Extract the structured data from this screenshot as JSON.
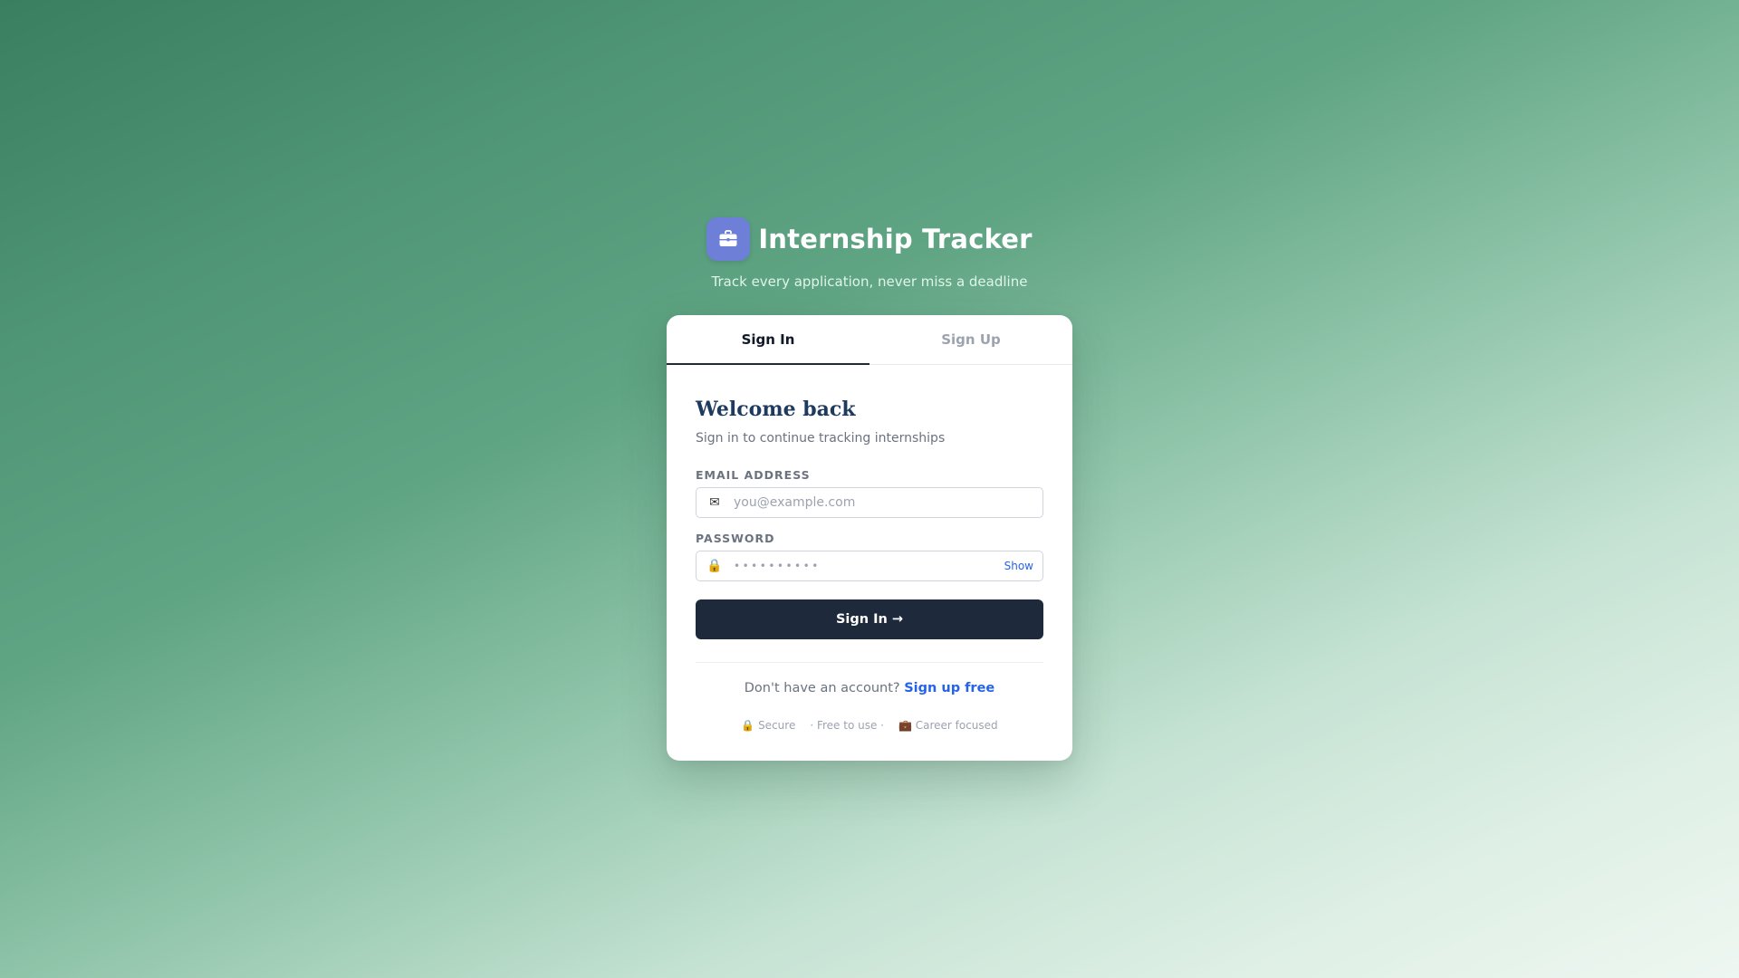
{
  "brand": {
    "title": "Internship Tracker",
    "tagline": "Track every application, never miss a deadline",
    "logo_icon": "briefcase-icon",
    "logo_color": "#6d7fd6"
  },
  "tabs": [
    {
      "label": "Sign In",
      "active": true
    },
    {
      "label": "Sign Up",
      "active": false
    }
  ],
  "form": {
    "title": "Welcome back",
    "subtitle": "Sign in to continue tracking internships",
    "email": {
      "label": "EMAIL ADDRESS",
      "placeholder": "you@example.com",
      "icon": "envelope-icon",
      "glyph": "✉"
    },
    "password": {
      "label": "PASSWORD",
      "masked_value": "••••••••••",
      "icon": "lock-icon",
      "glyph": "🔒",
      "show_label": "Show"
    },
    "submit_label": "Sign In →",
    "submit_color": "#1e293b"
  },
  "switch": {
    "prompt": "Don't have an account?",
    "link_label": "Sign up free",
    "link_color": "#2563eb"
  },
  "badges": {
    "secure": "🔒 Secure",
    "free": "· Free to use ·",
    "career": "💼 Career focused"
  }
}
